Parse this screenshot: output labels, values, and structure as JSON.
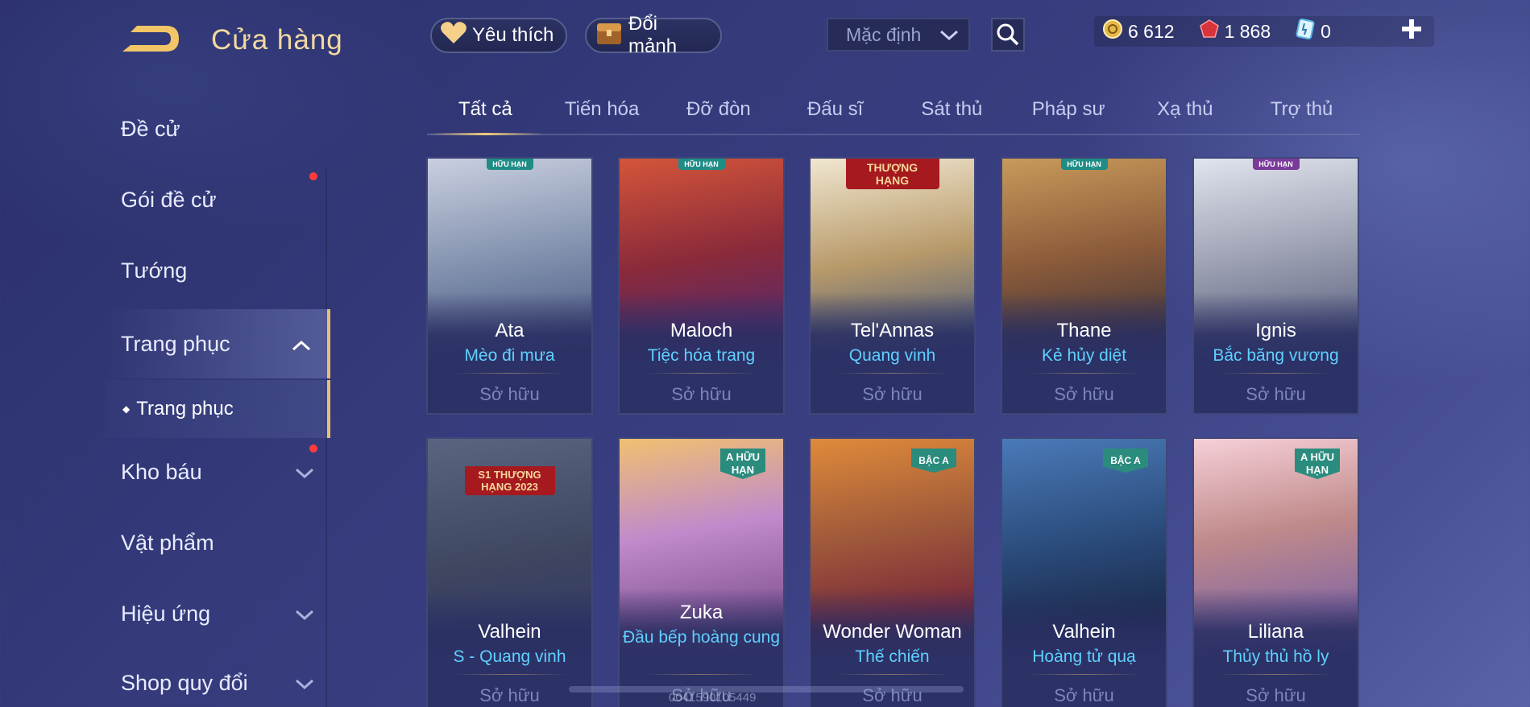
{
  "header": {
    "title": "Cửa hàng",
    "favorite_label": "Yêu thích",
    "exchange_label": "Đổi mảnh",
    "sort_dropdown": "Mặc định"
  },
  "currency": {
    "gold": "6 612",
    "vouchers": "1 868",
    "tickets": "0"
  },
  "sidebar": {
    "items": [
      {
        "label": "Đề cử"
      },
      {
        "label": "Gói đề cử"
      },
      {
        "label": "Tướng"
      },
      {
        "label": "Trang phục"
      },
      {
        "label": "Kho báu"
      },
      {
        "label": "Vật phẩm"
      },
      {
        "label": "Hiệu ứng"
      },
      {
        "label": "Shop quy đổi"
      }
    ],
    "sub_item": "Trang phục"
  },
  "tabs": [
    "Tất cả",
    "Tiến hóa",
    "Đỡ đòn",
    "Đấu sĩ",
    "Sát thủ",
    "Pháp sư",
    "Xạ thủ",
    "Trợ thủ"
  ],
  "cards": [
    {
      "hero": "Ata",
      "skin": "Mèo đi mưa",
      "status": "Sở hữu",
      "badge": "HỮU HẠN",
      "color": "#7a8aa8"
    },
    {
      "hero": "Maloch",
      "skin": "Tiệc hóa trang",
      "status": "Sở hữu",
      "badge": "HỮU HẠN",
      "color": "#8a2a3a"
    },
    {
      "hero": "Tel'Annas",
      "skin": "Quang vinh",
      "status": "Sở hữu",
      "badge": "THƯỢNG HẠNG",
      "color": "#b89a6a"
    },
    {
      "hero": "Thane",
      "skin": "Kẻ hủy diệt",
      "status": "Sở hữu",
      "badge": "HỮU HẠN",
      "color": "#8a5a3a"
    },
    {
      "hero": "Ignis",
      "skin": "Bắc băng vương",
      "status": "Sở hữu",
      "badge": "HỮU HẠN",
      "color": "#6a7088"
    },
    {
      "hero": "Valhein",
      "skin": "S - Quang vinh",
      "status": "Sở hữu",
      "badge": "S1 THƯỢNG HẠNG 2023",
      "color": "#3e4660"
    },
    {
      "hero": "Zuka",
      "skin": "Đầu bếp hoàng cung",
      "status": "Sở hữu",
      "badge": "A HỮU HẠN",
      "color": "#8a5a9a"
    },
    {
      "hero": "Wonder Woman",
      "skin": "Thế chiến",
      "status": "Sở hữu",
      "badge": "BẬC A",
      "color": "#a05a3a"
    },
    {
      "hero": "Valhein",
      "skin": "Hoàng tử quạ",
      "status": "Sở hữu",
      "badge": "BẬC A",
      "color": "#2a4a7a"
    },
    {
      "hero": "Liliana",
      "skin": "Thủy thủ hồ ly",
      "status": "Sở hữu",
      "badge": "A HỮU HẠN",
      "color": "#c08a8a"
    }
  ],
  "overlay_text": "0041590105449"
}
